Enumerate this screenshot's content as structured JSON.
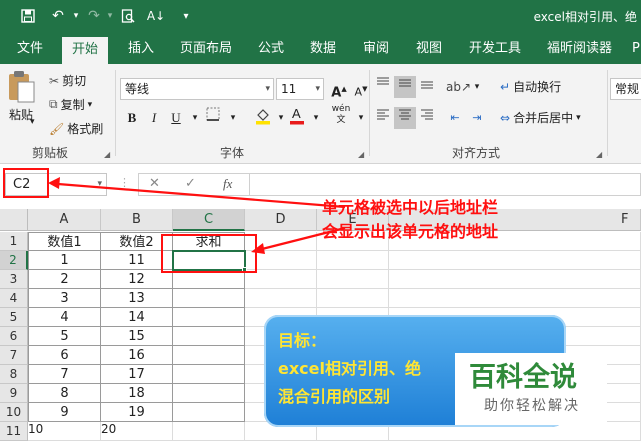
{
  "window": {
    "title": "excel相对引用、绝"
  },
  "quick_access": {
    "save_icon": "save-icon",
    "undo_icon": "undo-icon",
    "redo_icon": "redo-icon",
    "print_preview_icon": "print-preview-icon",
    "sort_icon": "sort-icon",
    "more_icon": "customize-icon"
  },
  "tabs": [
    "文件",
    "开始",
    "插入",
    "页面布局",
    "公式",
    "数据",
    "审阅",
    "视图",
    "开发工具",
    "福昕阅读器",
    "P"
  ],
  "active_tab": "开始",
  "ribbon": {
    "clipboard": {
      "paste": "粘贴",
      "cut": "剪切",
      "copy": "复制",
      "format_painter": "格式刷",
      "label": "剪贴板"
    },
    "font": {
      "font_name": "等线",
      "font_size": "11",
      "bold": "B",
      "italic": "I",
      "underline": "U",
      "grow": "A",
      "shrink": "A",
      "phonetic": "wén",
      "label": "字体"
    },
    "alignment": {
      "wrap_text": "自动换行",
      "merge_center": "合并后居中",
      "label": "对齐方式"
    },
    "number": {
      "format": "常规"
    }
  },
  "formula_bar": {
    "name_box": "C2",
    "fx": "fx",
    "value": ""
  },
  "grid": {
    "columns": [
      "A",
      "B",
      "C",
      "D",
      "E",
      "F"
    ],
    "rows": [
      "1",
      "2",
      "3",
      "4",
      "5",
      "6",
      "7",
      "8",
      "9",
      "10",
      "11"
    ],
    "header_row": [
      "数值1",
      "数值2",
      "求和"
    ],
    "data": [
      [
        "1",
        "11"
      ],
      [
        "2",
        "12"
      ],
      [
        "3",
        "13"
      ],
      [
        "4",
        "14"
      ],
      [
        "5",
        "15"
      ],
      [
        "6",
        "16"
      ],
      [
        "7",
        "17"
      ],
      [
        "8",
        "18"
      ],
      [
        "9",
        "19"
      ],
      [
        "10",
        "20"
      ]
    ],
    "selected_cell": "C2"
  },
  "annotation": {
    "line1": "单元格被选中以后地址栏",
    "line2": "会显示出该单元格的地址",
    "color": "#ff1010"
  },
  "goal_box": {
    "line1": "目标：",
    "line2": "excel相对引用、绝",
    "line3": "混合引用的区别"
  },
  "watermark": {
    "title": "百科全说",
    "subtitle": "助你轻松解决"
  },
  "colors": {
    "excel_green": "#217346",
    "annotation_red": "#ff1010",
    "goal_text": "#ffe533"
  }
}
